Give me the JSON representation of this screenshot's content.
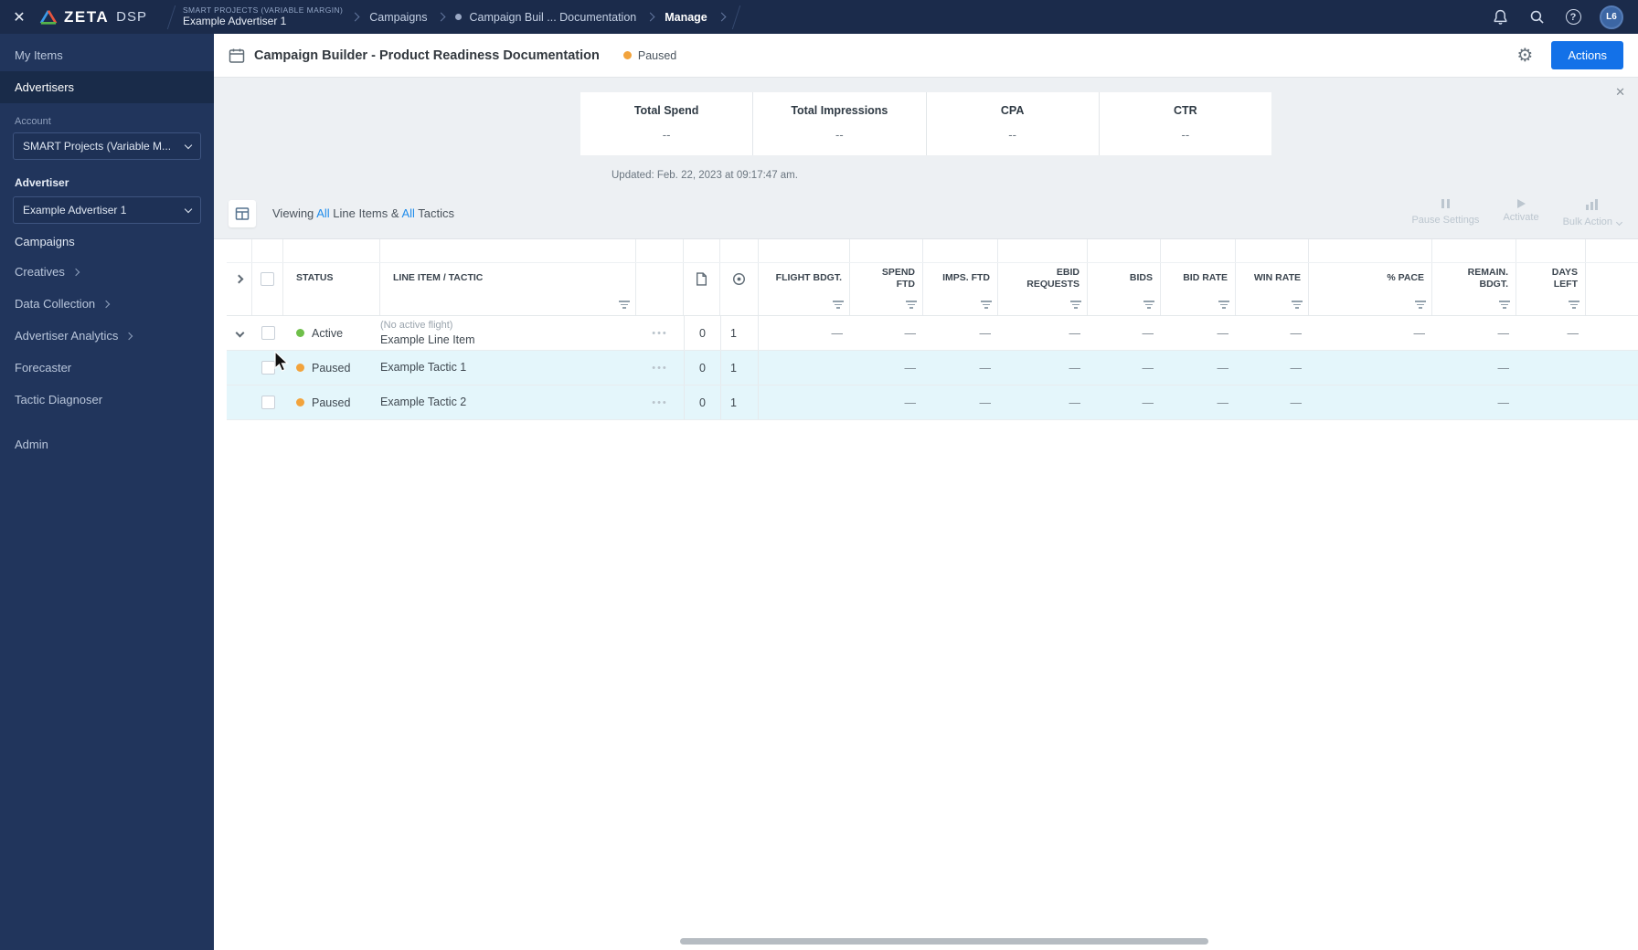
{
  "colors": {
    "navy_topbar": "#1b2b4b",
    "navy_sidebar": "#21355c",
    "accent_blue": "#1371e8",
    "link_blue": "#1f8ceb",
    "active_green": "#6fbf4a",
    "paused_orange": "#f2a33c",
    "row_highlight": "#e4f6fb"
  },
  "icons": {
    "close": "✕",
    "stats_close": "✕",
    "more": "•••",
    "gear": "⚙"
  },
  "topbar": {
    "brand": "ZETA",
    "brand_suffix": "DSP",
    "crumb_account_label": "SMART PROJECTS (VARIABLE MARGIN)",
    "crumb_advertiser": "Example Advertiser 1",
    "crumb_campaigns": "Campaigns",
    "crumb_campaign": "Campaign Buil ... Documentation",
    "crumb_manage": "Manage",
    "avatar_initials": "L6"
  },
  "sidebar": {
    "my_items": "My Items",
    "advertisers": "Advertisers",
    "account_label": "Account",
    "account_value": "SMART Projects (Variable M...",
    "advertiser_label": "Advertiser",
    "advertiser_value": "Example Advertiser 1",
    "campaigns": "Campaigns",
    "creatives": "Creatives",
    "data_collection": "Data Collection",
    "advertiser_analytics": "Advertiser Analytics",
    "forecaster": "Forecaster",
    "tactic_diagnoser": "Tactic Diagnoser",
    "admin": "Admin"
  },
  "header": {
    "title": "Campaign Builder - Product Readiness Documentation",
    "status": "Paused",
    "actions_label": "Actions"
  },
  "stats": {
    "cards": [
      {
        "label": "Total Spend",
        "value": "--"
      },
      {
        "label": "Total Impressions",
        "value": "--"
      },
      {
        "label": "CPA",
        "value": "--"
      },
      {
        "label": "CTR",
        "value": "--"
      }
    ],
    "updated": "Updated: Feb. 22, 2023 at 09:17:47 am."
  },
  "toolbar": {
    "viewing": "Viewing",
    "all_a": "All",
    "line_items": "Line Items &",
    "all_b": "All",
    "tactics": "Tactics",
    "pause_settings": "Pause Settings",
    "activate": "Activate",
    "bulk_action": "Bulk Action"
  },
  "table": {
    "headers": {
      "status": "STATUS",
      "line_item": "LINE ITEM / TACTIC",
      "flight": "FLIGHT BDGT.",
      "spend": "SPEND FTD",
      "imps": "IMPS. FTD",
      "ebid": "EBID REQUESTS",
      "bids": "BIDS",
      "bid_rate": "BID RATE",
      "win_rate": "WIN RATE",
      "pace": "% PACE",
      "remain": "REMAIN. BDGT.",
      "days": "DAYS LEFT"
    },
    "rows": [
      {
        "status": "Active",
        "note": "(No active flight)",
        "name": "Example Line Item",
        "doc": "0",
        "target": "1",
        "flight": "—",
        "spend": "—",
        "imps": "—",
        "ebid": "—",
        "bids": "—",
        "bid_rate": "—",
        "win_rate": "—",
        "pace": "—",
        "remain": "—",
        "days": "—"
      },
      {
        "status": "Paused",
        "name": "Example Tactic 1",
        "doc": "0",
        "target": "1",
        "flight": "",
        "spend": "—",
        "imps": "—",
        "ebid": "—",
        "bids": "—",
        "bid_rate": "—",
        "win_rate": "—",
        "pace": "",
        "remain": "—",
        "days": ""
      },
      {
        "status": "Paused",
        "name": "Example Tactic 2",
        "doc": "0",
        "target": "1",
        "flight": "",
        "spend": "—",
        "imps": "—",
        "ebid": "—",
        "bids": "—",
        "bid_rate": "—",
        "win_rate": "—",
        "pace": "",
        "remain": "—",
        "days": ""
      }
    ]
  }
}
